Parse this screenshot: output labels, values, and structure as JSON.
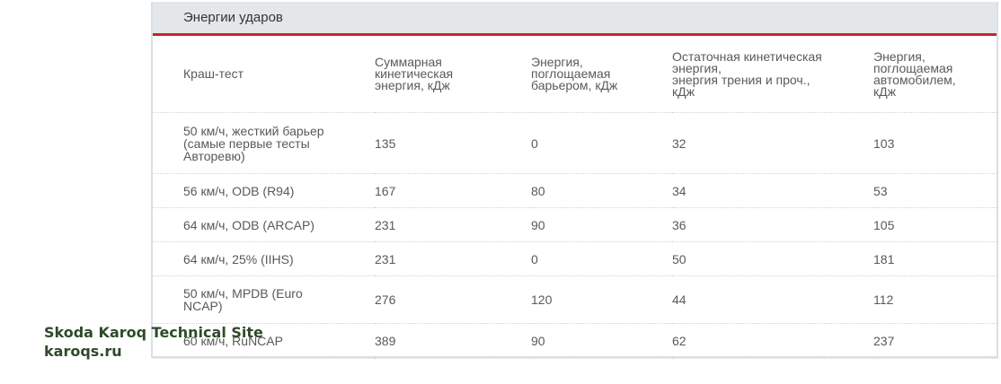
{
  "table": {
    "title": "Энергии ударов",
    "headers": [
      "Краш-тест",
      "Суммарная\nкинетическая\nэнергия, кДж",
      "Энергия,\nпоглощаемая\nбарьером, кДж",
      "Остаточная кинетическая\nэнергия,\nэнергия трения и проч.,\nкДж",
      "Энергия,\nпоглощаемая\nавтомобилем,\nкДж"
    ],
    "rows": [
      [
        "50 км/ч, жесткий барьер\n(самые первые тесты\nАвторевю)",
        "135",
        "0",
        "32",
        "103"
      ],
      [
        "56 км/ч, ODB (R94)",
        "167",
        "80",
        "34",
        "53"
      ],
      [
        "64 км/ч, ODB (ARCAP)",
        "231",
        "90",
        "36",
        "105"
      ],
      [
        "64 км/ч, 25% (IIHS)",
        "231",
        "0",
        "50",
        "181"
      ],
      [
        "50 км/ч, MPDB (Euro\nNCAP)",
        "276",
        "120",
        "44",
        "112"
      ],
      [
        "60 км/ч, RuNCAP",
        "389",
        "90",
        "62",
        "237"
      ]
    ]
  },
  "watermark": {
    "line1": "Skoda Karoq Technical Site",
    "line2": "karoqs.ru"
  },
  "colors": {
    "accent_red": "#c0262d",
    "header_bg": "#e4e7ea",
    "watermark": "#2f4a2a"
  }
}
